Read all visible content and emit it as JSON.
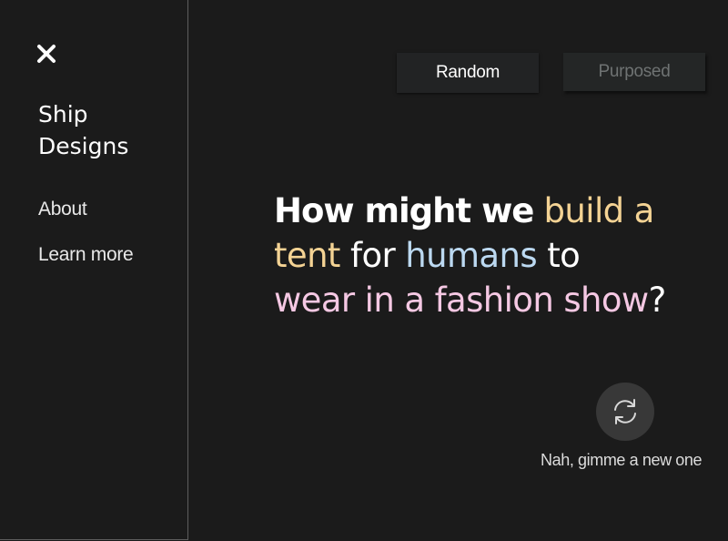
{
  "sidebar": {
    "close_icon": "close-icon",
    "brand_line1": "Ship",
    "brand_line2": "Designs",
    "items": [
      {
        "label": "About"
      },
      {
        "label": "Learn more"
      }
    ]
  },
  "mode_toggle": {
    "random_label": "Random",
    "purposed_label": "Purposed",
    "active": "Random"
  },
  "prompt": {
    "lead": "How might we",
    "action": "build a tent",
    "connector": "for",
    "audience": "humans",
    "to": "to",
    "context": "wear in a fashion show",
    "end": "?"
  },
  "refresh": {
    "icon": "refresh-icon",
    "caption": "Nah, gimme a new one"
  },
  "colors": {
    "background": "#1b1b1b",
    "action": "#f4d394",
    "audience": "#bcd9f1",
    "context": "#f5c8e3",
    "button_bg": "#222324",
    "refresh_bg": "#383838"
  }
}
